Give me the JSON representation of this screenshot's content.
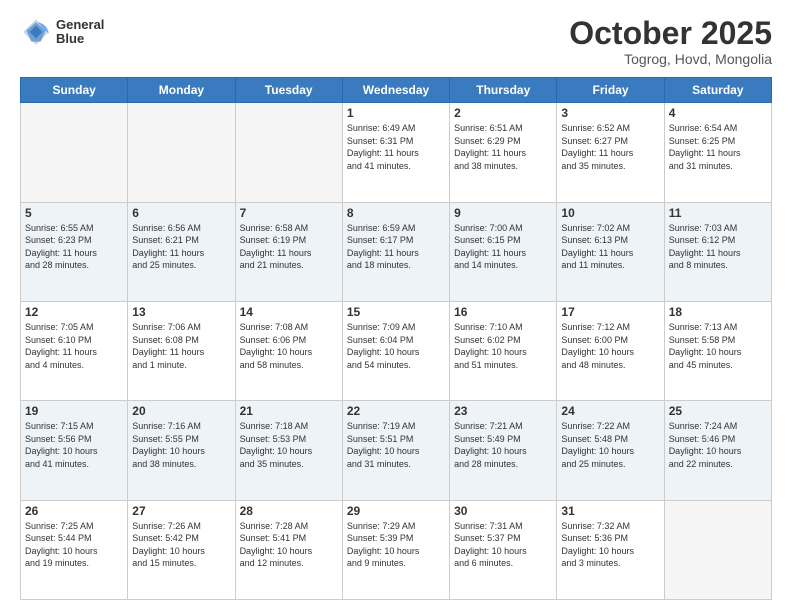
{
  "header": {
    "logo_line1": "General",
    "logo_line2": "Blue",
    "month": "October 2025",
    "location": "Togrog, Hovd, Mongolia"
  },
  "weekdays": [
    "Sunday",
    "Monday",
    "Tuesday",
    "Wednesday",
    "Thursday",
    "Friday",
    "Saturday"
  ],
  "weeks": [
    [
      {
        "day": "",
        "info": ""
      },
      {
        "day": "",
        "info": ""
      },
      {
        "day": "",
        "info": ""
      },
      {
        "day": "1",
        "info": "Sunrise: 6:49 AM\nSunset: 6:31 PM\nDaylight: 11 hours\nand 41 minutes."
      },
      {
        "day": "2",
        "info": "Sunrise: 6:51 AM\nSunset: 6:29 PM\nDaylight: 11 hours\nand 38 minutes."
      },
      {
        "day": "3",
        "info": "Sunrise: 6:52 AM\nSunset: 6:27 PM\nDaylight: 11 hours\nand 35 minutes."
      },
      {
        "day": "4",
        "info": "Sunrise: 6:54 AM\nSunset: 6:25 PM\nDaylight: 11 hours\nand 31 minutes."
      }
    ],
    [
      {
        "day": "5",
        "info": "Sunrise: 6:55 AM\nSunset: 6:23 PM\nDaylight: 11 hours\nand 28 minutes."
      },
      {
        "day": "6",
        "info": "Sunrise: 6:56 AM\nSunset: 6:21 PM\nDaylight: 11 hours\nand 25 minutes."
      },
      {
        "day": "7",
        "info": "Sunrise: 6:58 AM\nSunset: 6:19 PM\nDaylight: 11 hours\nand 21 minutes."
      },
      {
        "day": "8",
        "info": "Sunrise: 6:59 AM\nSunset: 6:17 PM\nDaylight: 11 hours\nand 18 minutes."
      },
      {
        "day": "9",
        "info": "Sunrise: 7:00 AM\nSunset: 6:15 PM\nDaylight: 11 hours\nand 14 minutes."
      },
      {
        "day": "10",
        "info": "Sunrise: 7:02 AM\nSunset: 6:13 PM\nDaylight: 11 hours\nand 11 minutes."
      },
      {
        "day": "11",
        "info": "Sunrise: 7:03 AM\nSunset: 6:12 PM\nDaylight: 11 hours\nand 8 minutes."
      }
    ],
    [
      {
        "day": "12",
        "info": "Sunrise: 7:05 AM\nSunset: 6:10 PM\nDaylight: 11 hours\nand 4 minutes."
      },
      {
        "day": "13",
        "info": "Sunrise: 7:06 AM\nSunset: 6:08 PM\nDaylight: 11 hours\nand 1 minute."
      },
      {
        "day": "14",
        "info": "Sunrise: 7:08 AM\nSunset: 6:06 PM\nDaylight: 10 hours\nand 58 minutes."
      },
      {
        "day": "15",
        "info": "Sunrise: 7:09 AM\nSunset: 6:04 PM\nDaylight: 10 hours\nand 54 minutes."
      },
      {
        "day": "16",
        "info": "Sunrise: 7:10 AM\nSunset: 6:02 PM\nDaylight: 10 hours\nand 51 minutes."
      },
      {
        "day": "17",
        "info": "Sunrise: 7:12 AM\nSunset: 6:00 PM\nDaylight: 10 hours\nand 48 minutes."
      },
      {
        "day": "18",
        "info": "Sunrise: 7:13 AM\nSunset: 5:58 PM\nDaylight: 10 hours\nand 45 minutes."
      }
    ],
    [
      {
        "day": "19",
        "info": "Sunrise: 7:15 AM\nSunset: 5:56 PM\nDaylight: 10 hours\nand 41 minutes."
      },
      {
        "day": "20",
        "info": "Sunrise: 7:16 AM\nSunset: 5:55 PM\nDaylight: 10 hours\nand 38 minutes."
      },
      {
        "day": "21",
        "info": "Sunrise: 7:18 AM\nSunset: 5:53 PM\nDaylight: 10 hours\nand 35 minutes."
      },
      {
        "day": "22",
        "info": "Sunrise: 7:19 AM\nSunset: 5:51 PM\nDaylight: 10 hours\nand 31 minutes."
      },
      {
        "day": "23",
        "info": "Sunrise: 7:21 AM\nSunset: 5:49 PM\nDaylight: 10 hours\nand 28 minutes."
      },
      {
        "day": "24",
        "info": "Sunrise: 7:22 AM\nSunset: 5:48 PM\nDaylight: 10 hours\nand 25 minutes."
      },
      {
        "day": "25",
        "info": "Sunrise: 7:24 AM\nSunset: 5:46 PM\nDaylight: 10 hours\nand 22 minutes."
      }
    ],
    [
      {
        "day": "26",
        "info": "Sunrise: 7:25 AM\nSunset: 5:44 PM\nDaylight: 10 hours\nand 19 minutes."
      },
      {
        "day": "27",
        "info": "Sunrise: 7:26 AM\nSunset: 5:42 PM\nDaylight: 10 hours\nand 15 minutes."
      },
      {
        "day": "28",
        "info": "Sunrise: 7:28 AM\nSunset: 5:41 PM\nDaylight: 10 hours\nand 12 minutes."
      },
      {
        "day": "29",
        "info": "Sunrise: 7:29 AM\nSunset: 5:39 PM\nDaylight: 10 hours\nand 9 minutes."
      },
      {
        "day": "30",
        "info": "Sunrise: 7:31 AM\nSunset: 5:37 PM\nDaylight: 10 hours\nand 6 minutes."
      },
      {
        "day": "31",
        "info": "Sunrise: 7:32 AM\nSunset: 5:36 PM\nDaylight: 10 hours\nand 3 minutes."
      },
      {
        "day": "",
        "info": ""
      }
    ]
  ]
}
